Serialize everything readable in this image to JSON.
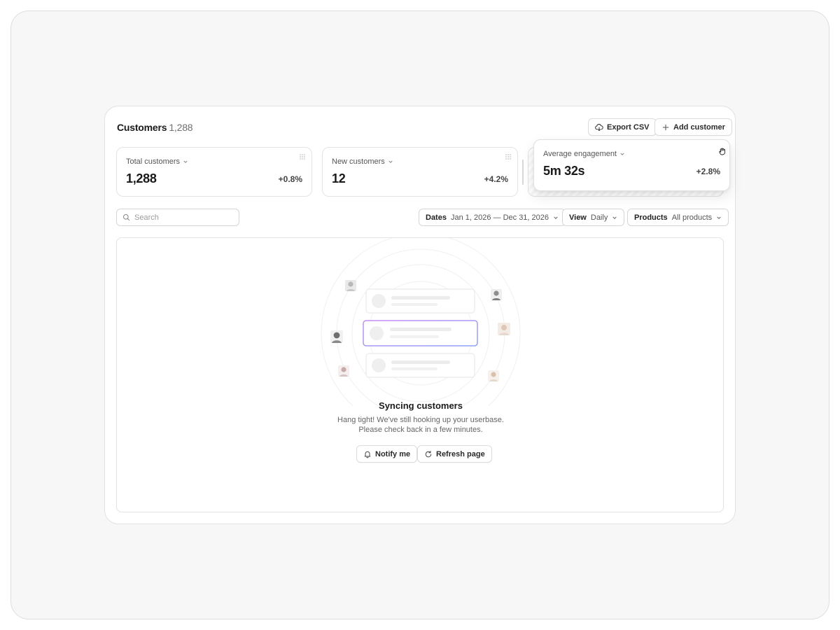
{
  "header": {
    "title": "Customers",
    "count": "1,288"
  },
  "actions": {
    "export_label": "Export CSV",
    "add_label": "Add customer"
  },
  "metrics": [
    {
      "label": "Total customers",
      "value": "1,288",
      "delta": "+0.8%"
    },
    {
      "label": "New customers",
      "value": "12",
      "delta": "+4.2%"
    },
    {
      "label": "Average engagement",
      "value": "5m 32s",
      "delta": "+2.8%"
    }
  ],
  "search": {
    "placeholder": "Search",
    "value": ""
  },
  "filters": {
    "dates": {
      "label": "Dates",
      "value": "Jan 1, 2026 — Dec 31, 2026"
    },
    "view": {
      "label": "View",
      "value": "Daily"
    },
    "products": {
      "label": "Products",
      "value": "All products"
    }
  },
  "empty_state": {
    "title": "Syncing customers",
    "desc_line1": "Hang tight! We've still hooking up your userbase.",
    "desc_line2": "Please check back in a few minutes.",
    "notify_label": "Notify me",
    "refresh_label": "Refresh page"
  },
  "colors": {
    "accent_highlight": "#b07cf0",
    "border": "#e3e3e3",
    "background": "#f7f7f7"
  }
}
